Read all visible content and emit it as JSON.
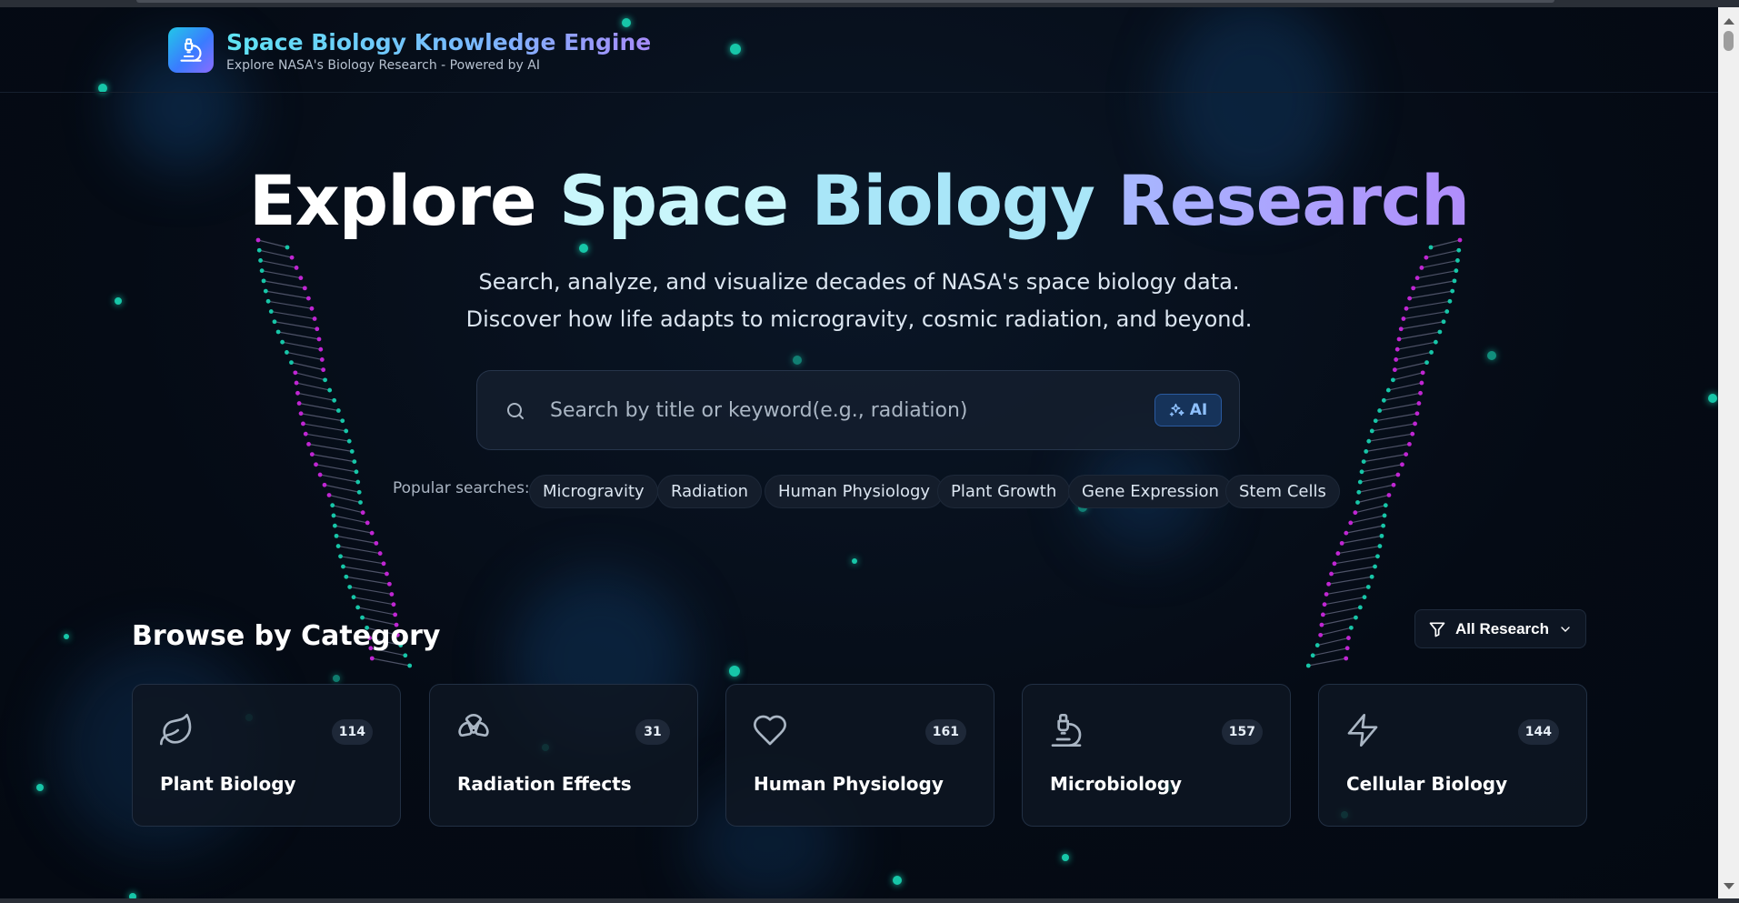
{
  "header": {
    "title": "Space Biology Knowledge Engine",
    "subtitle": "Explore NASA's Biology Research - Powered by AI"
  },
  "hero": {
    "title_words": [
      "Explore",
      "Space",
      "Biology",
      "Research"
    ],
    "subtitle_line1": "Search, analyze, and visualize decades of NASA's space biology data.",
    "subtitle_line2": "Discover how life adapts to microgravity, cosmic radiation, and beyond."
  },
  "search": {
    "placeholder": "Search by title or keyword(e.g., radiation)",
    "value": "",
    "ai_label": "AI"
  },
  "popular": {
    "label": "Popular searches:",
    "items": [
      "Microgravity",
      "Radiation",
      "Human Physiology",
      "Plant Growth",
      "Gene Expression",
      "Stem Cells"
    ]
  },
  "categories": {
    "title": "Browse by Category",
    "filter_label": "All Research",
    "items": [
      {
        "label": "Plant Biology",
        "count": "114",
        "icon": "leaf-icon"
      },
      {
        "label": "Radiation Effects",
        "count": "31",
        "icon": "radiation-icon"
      },
      {
        "label": "Human Physiology",
        "count": "161",
        "icon": "heart-icon"
      },
      {
        "label": "Microbiology",
        "count": "157",
        "icon": "microscope-icon"
      },
      {
        "label": "Cellular Biology",
        "count": "144",
        "icon": "lightning-icon"
      }
    ]
  },
  "colors": {
    "background": "#060d18",
    "accent_cyan": "#5fe4f4",
    "accent_purple": "#a78bfa",
    "dna_teal": "#17c6a8",
    "dna_magenta": "#c026d3"
  }
}
